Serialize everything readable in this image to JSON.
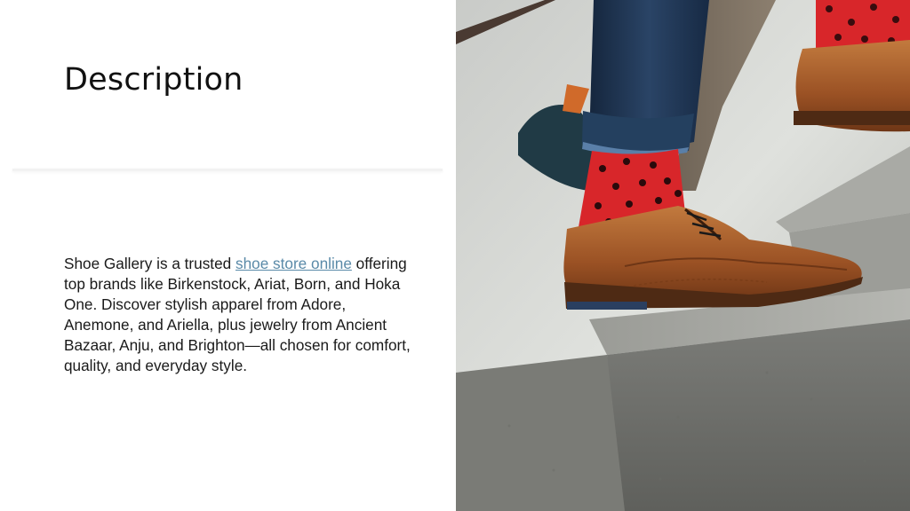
{
  "slide": {
    "title": "Description",
    "body": {
      "before_link": "Shoe Gallery is a trusted ",
      "link_text": "shoe store online",
      "after_link": " offering top brands like Birkenstock, Ariat, Born, and Hoka One. Discover stylish apparel from Adore, Anemone, and Ariella, plus jewelry from Ancient Bazaar, Anju, and Brighton—all chosen for comfort, quality, and everyday style."
    }
  },
  "colors": {
    "link": "#5a8aa8",
    "sock_red": "#d8262a",
    "shoe_brown": "#a0562a",
    "jeans_navy": "#1e3350"
  }
}
